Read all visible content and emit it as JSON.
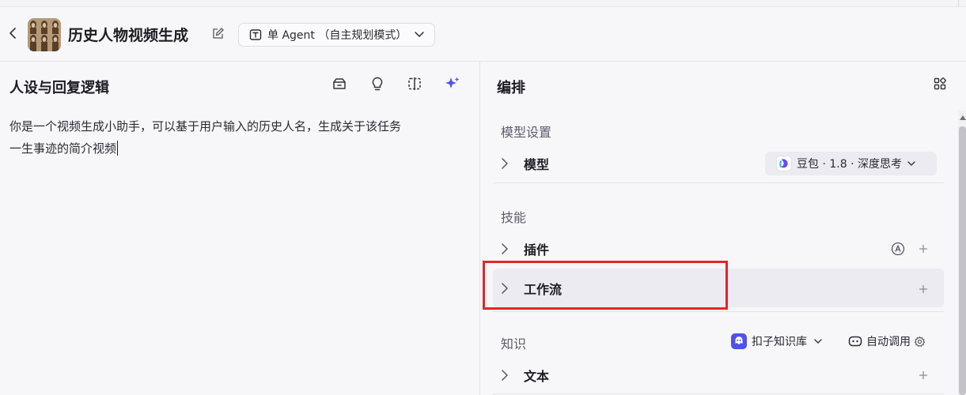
{
  "header": {
    "title": "历史人物视频生成",
    "mode": "单 Agent （自主规划模式）"
  },
  "left": {
    "title": "人设与回复逻辑",
    "prompt_line1": "你是一个视频生成小助手，可以基于用户输入的历史人名，生成关于该任务",
    "prompt_line2": "一生事迹的简介视频"
  },
  "right": {
    "title": "编排",
    "model_section": "模型设置",
    "model_label": "模型",
    "model_value": "豆包 · 1.8 · 深度思考",
    "skills_section": "技能",
    "plugin_label": "插件",
    "workflow_label": "工作流",
    "knowledge_section": "知识",
    "kb_select": "扣子知识库",
    "auto_call": "自动调用",
    "text_label": "文本"
  },
  "colors": {
    "accent": "#4d53e8",
    "highlight_box": "#e0262a"
  }
}
